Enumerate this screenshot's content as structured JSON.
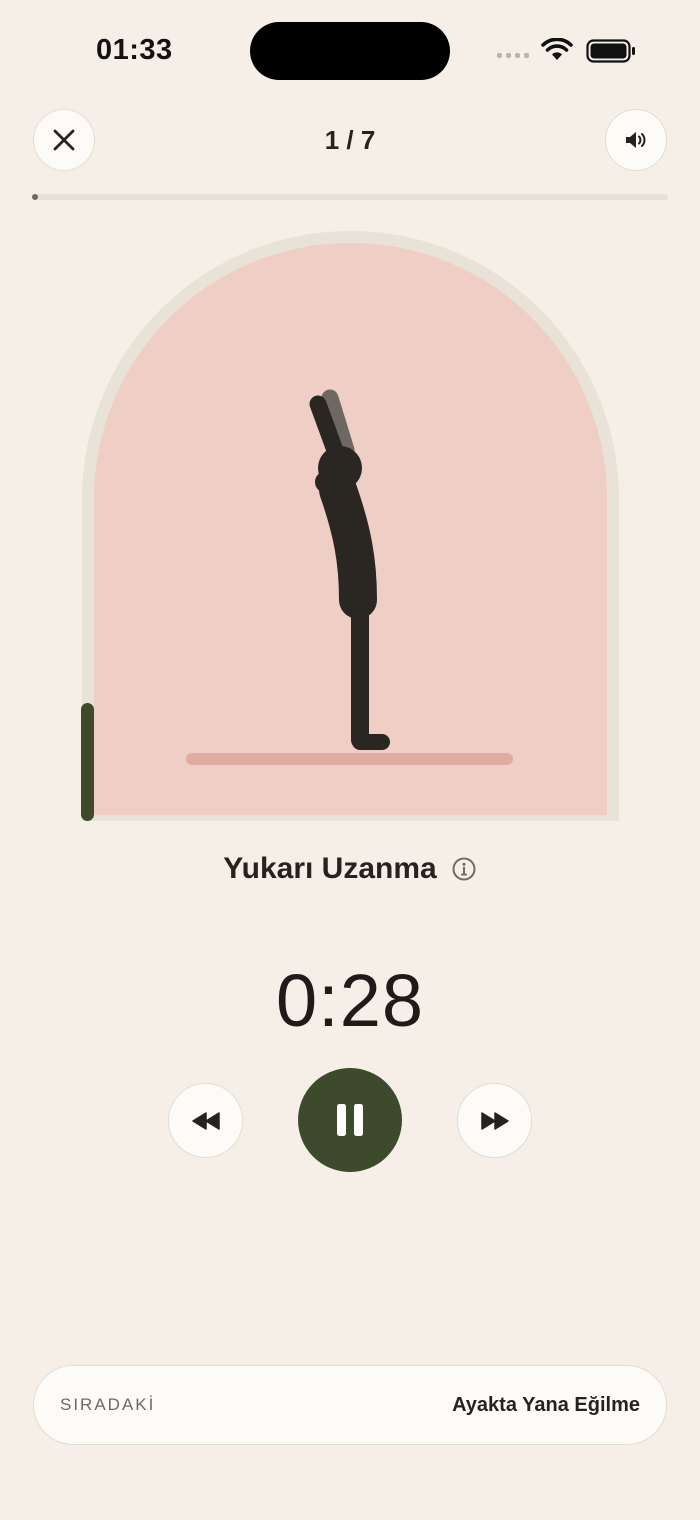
{
  "status_bar": {
    "time": "01:33"
  },
  "header": {
    "step_counter": "1 / 7",
    "progress": 0.01
  },
  "exercise": {
    "name": "Yukarı Uzanma",
    "timer": "0:28",
    "arch_progress": 0.2
  },
  "next": {
    "label": "SIRADAKİ",
    "name": "Ayakta Yana Eğilme"
  },
  "colors": {
    "accent": "#3D4B2C",
    "background": "#F5EFE8",
    "arch": "#EFCEC5",
    "figure": "#2A2622"
  },
  "icons": {
    "close": "close-icon",
    "sound": "speaker-icon",
    "info": "info-icon",
    "rewind": "rewind-icon",
    "pause": "pause-icon",
    "forward": "fast-forward-icon"
  }
}
